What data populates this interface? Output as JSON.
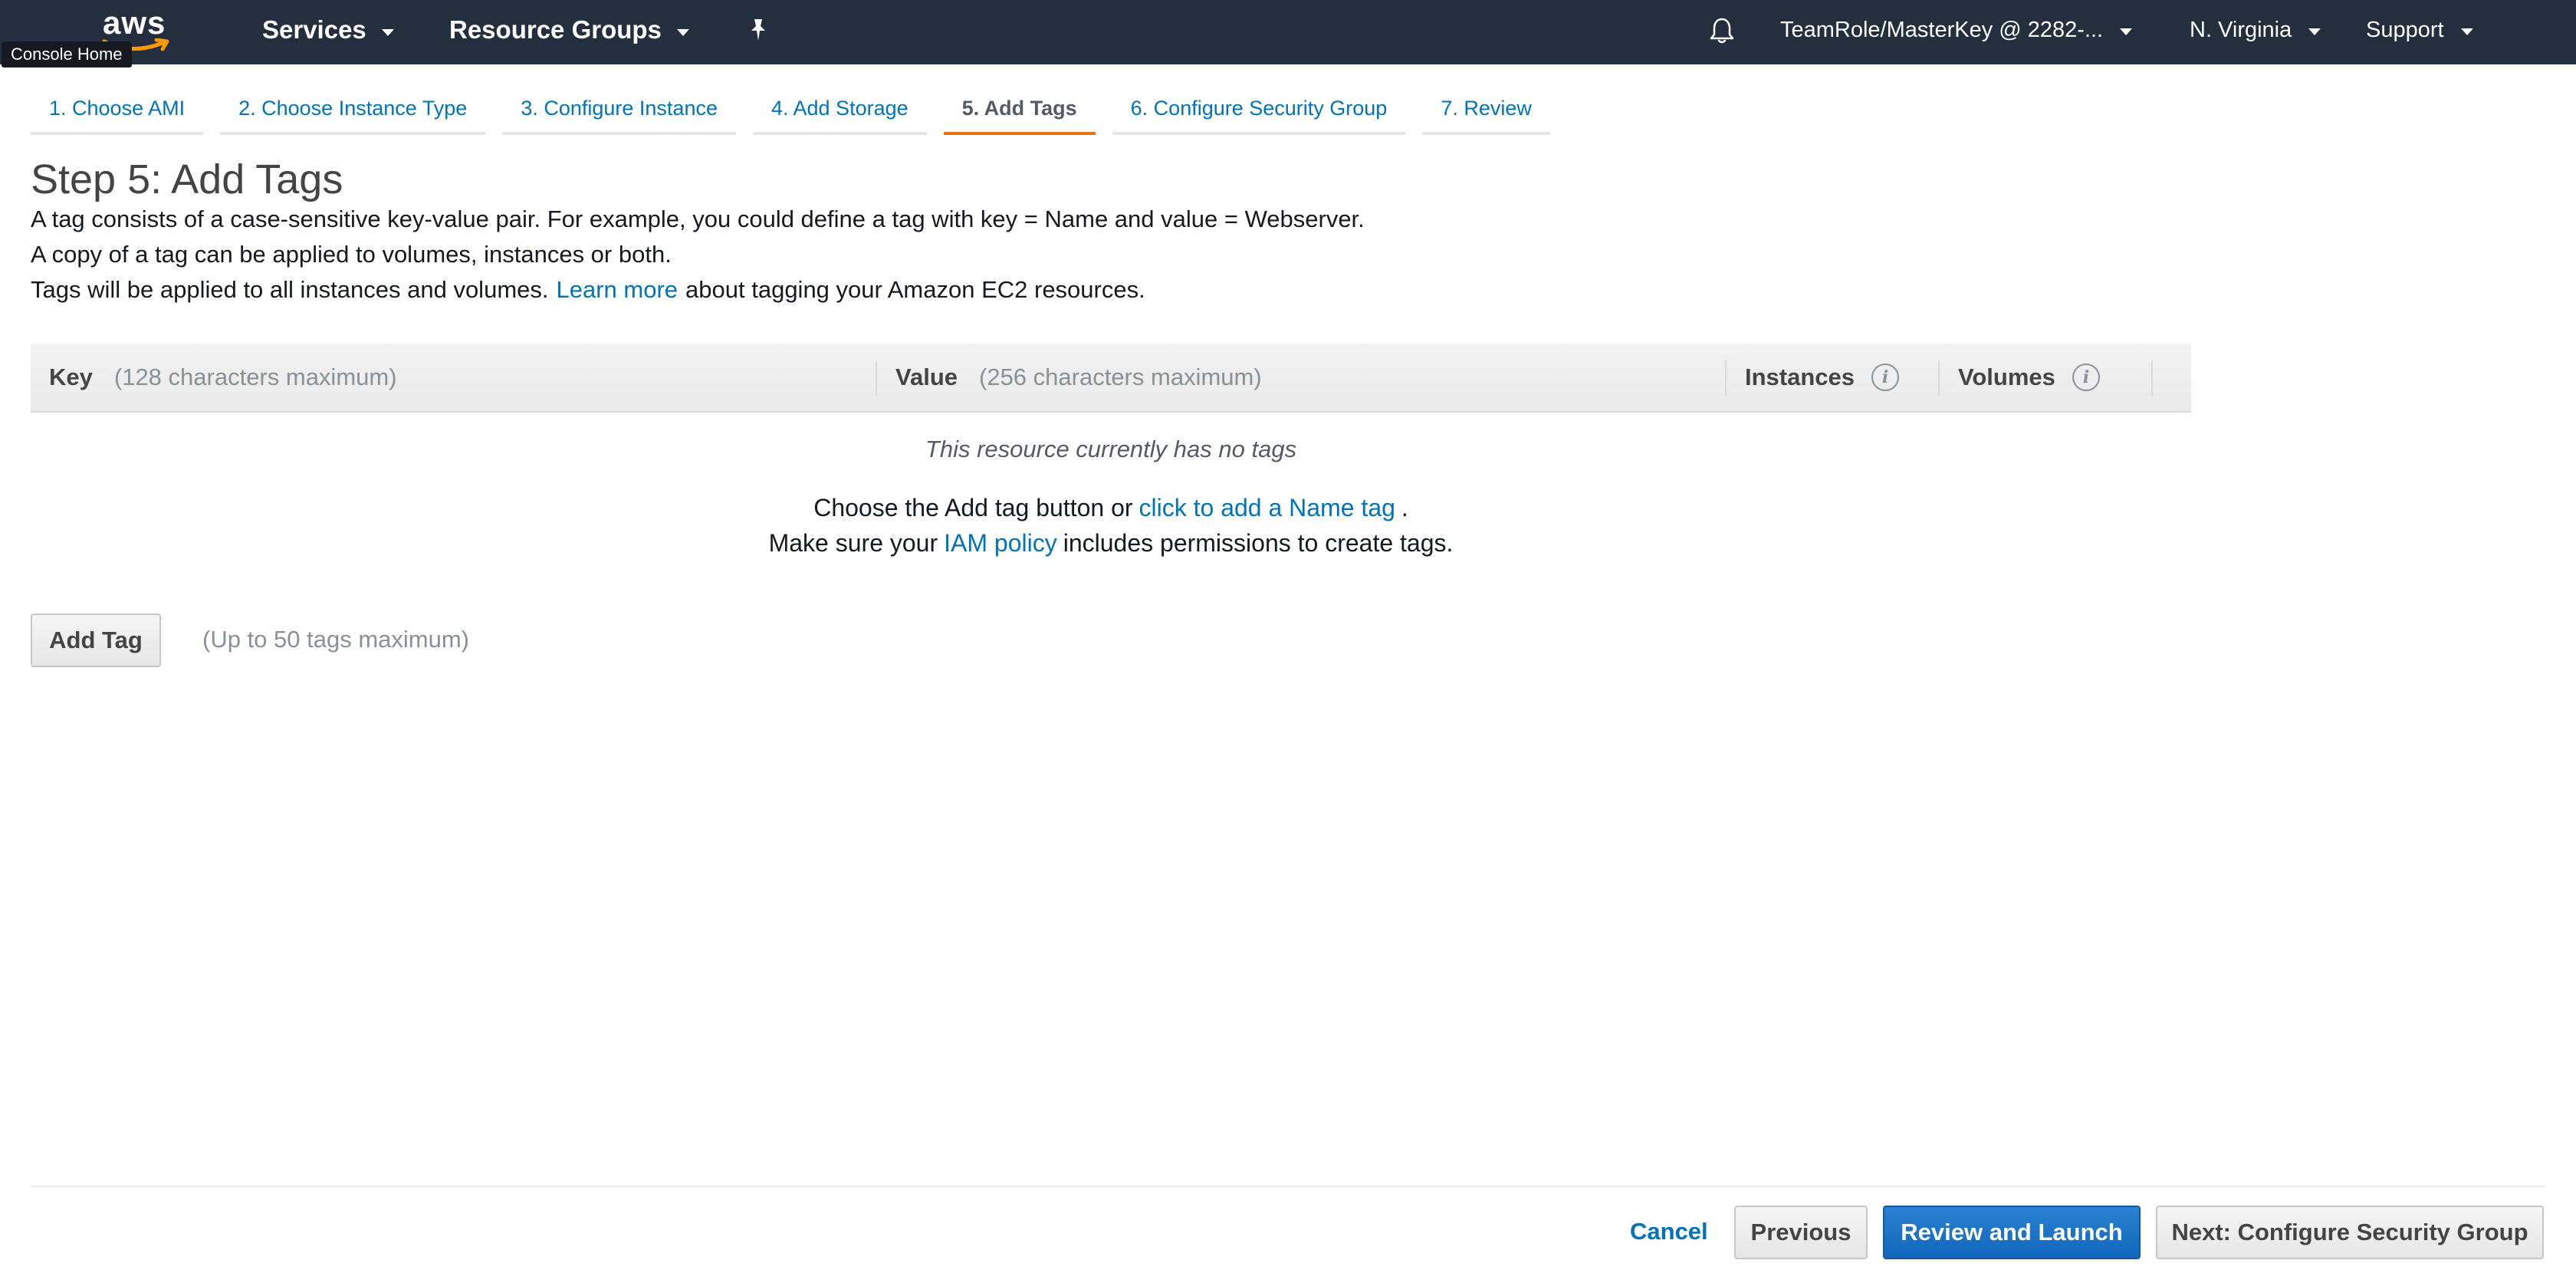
{
  "nav": {
    "logo_text": "aws",
    "console_home_tooltip": "Console Home",
    "services": "Services",
    "resource_groups": "Resource Groups",
    "account": "TeamRole/MasterKey @ 2282-...",
    "region": "N. Virginia",
    "support": "Support",
    "colors": {
      "background": "#232f3e",
      "logo_smile": "#ff9900"
    }
  },
  "wizard": {
    "steps": [
      {
        "label": "1. Choose AMI"
      },
      {
        "label": "2. Choose Instance Type"
      },
      {
        "label": "3. Configure Instance"
      },
      {
        "label": "4. Add Storage"
      },
      {
        "label": "5. Add Tags"
      },
      {
        "label": "6. Configure Security Group"
      },
      {
        "label": "7. Review"
      }
    ],
    "active_step_index": 4,
    "active_color": "#ec7211"
  },
  "page": {
    "title": "Step 5: Add Tags",
    "description_line1": "A tag consists of a case-sensitive key-value pair. For example, you could define a tag with key = Name and value = Webserver.",
    "description_line2": "A copy of a tag can be applied to volumes, instances or both.",
    "description_line3_before": "Tags will be applied to all instances and volumes.",
    "description_line3_link": "Learn more",
    "description_line3_after": "about tagging your Amazon EC2 resources."
  },
  "table": {
    "key_label": "Key",
    "key_hint": "(128 characters maximum)",
    "value_label": "Value",
    "value_hint": "(256 characters maximum)",
    "instances_label": "Instances",
    "volumes_label": "Volumes",
    "info_glyph": "i",
    "empty_message": "This resource currently has no tags",
    "help_line1_before": "Choose the Add tag button or",
    "help_line1_link": "click to add a Name tag",
    "help_line1_after": ".",
    "help_line2_before": "Make sure your",
    "help_line2_link": "IAM policy",
    "help_line2_after": "includes permissions to create tags."
  },
  "actions": {
    "add_tag": "Add Tag",
    "max_tags": "(Up to 50 tags maximum)",
    "cancel": "Cancel",
    "previous": "Previous",
    "review_and_launch": "Review and Launch",
    "next": "Next: Configure Security Group"
  }
}
